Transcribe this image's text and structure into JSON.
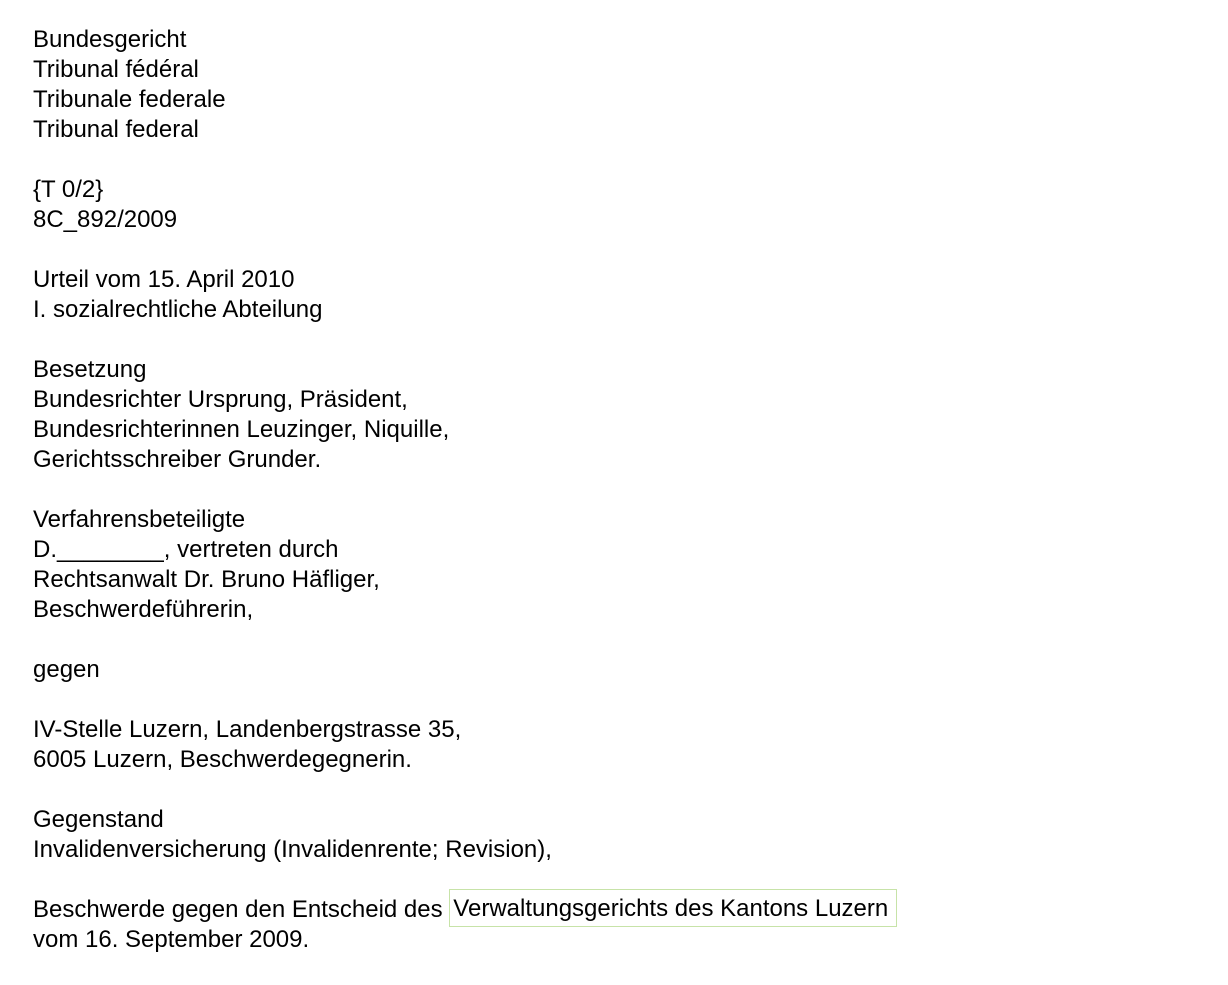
{
  "court": {
    "names": [
      "Bundesgericht",
      "Tribunal fédéral",
      "Tribunale federale",
      "Tribunal federal"
    ]
  },
  "reference": {
    "code": "{T 0/2}",
    "case_number": "8C_892/2009"
  },
  "judgment": {
    "date_line": "Urteil vom 15. April 2010",
    "division": "I. sozialrechtliche Abteilung"
  },
  "composition": {
    "heading": "Besetzung",
    "lines": [
      "Bundesrichter Ursprung, Präsident,",
      "Bundesrichterinnen Leuzinger, Niquille,",
      "Gerichtsschreiber Grunder."
    ]
  },
  "parties": {
    "heading": "Verfahrensbeteiligte",
    "appellant_lines": [
      "D.________, vertreten durch",
      "Rechtsanwalt Dr. Bruno Häfliger,",
      "Beschwerdeführerin,"
    ],
    "versus": "gegen",
    "respondent_lines": [
      "IV-Stelle Luzern, Landenbergstrasse 35,",
      "6005 Luzern, Beschwerdegegnerin."
    ]
  },
  "subject": {
    "heading": "Gegenstand",
    "line": "Invalidenversicherung (Invalidenrente; Revision),"
  },
  "appeal": {
    "prefix": "Beschwerde gegen den Entscheid des ",
    "highlighted": "Verwaltungsgerichts des Kantons Luzern",
    "suffix_line": "vom 16. September 2009."
  },
  "colors": {
    "highlight_border": "#c7e3a8",
    "text": "#000000",
    "background": "#ffffff"
  }
}
